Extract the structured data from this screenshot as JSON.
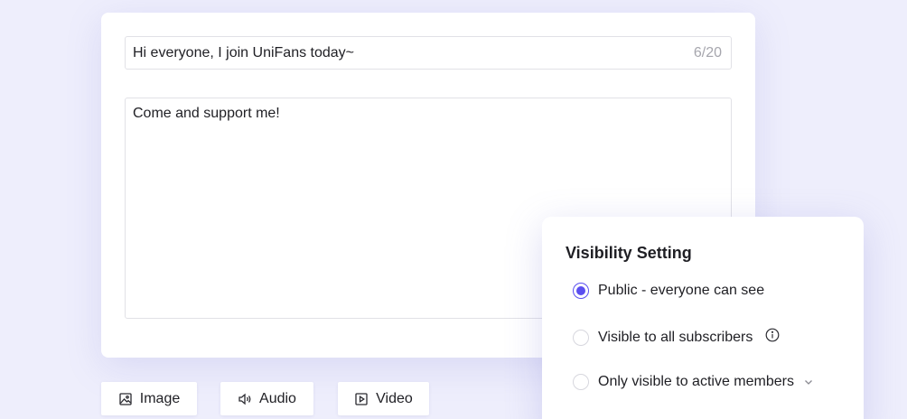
{
  "editor": {
    "title_value": "Hi everyone, I join UniFans today~",
    "title_counter": "6/20",
    "body_value": "Come and support me!"
  },
  "media_buttons": [
    {
      "label": "Image",
      "icon": "image-icon"
    },
    {
      "label": "Audio",
      "icon": "audio-icon"
    },
    {
      "label": "Video",
      "icon": "video-icon"
    }
  ],
  "visibility": {
    "title": "Visibility Setting",
    "options": [
      {
        "label": "Public - everyone can see",
        "selected": true
      },
      {
        "label": "Visible to all subscribers",
        "selected": false,
        "icon": "info-icon"
      },
      {
        "label": "Only visible to active members",
        "selected": false,
        "icon": "chevron-down-icon"
      }
    ]
  },
  "colors": {
    "background": "#eeeefc",
    "accent": "#5b4ff0",
    "border": "#e1e1e6",
    "muted_text": "#a6a6ad"
  }
}
